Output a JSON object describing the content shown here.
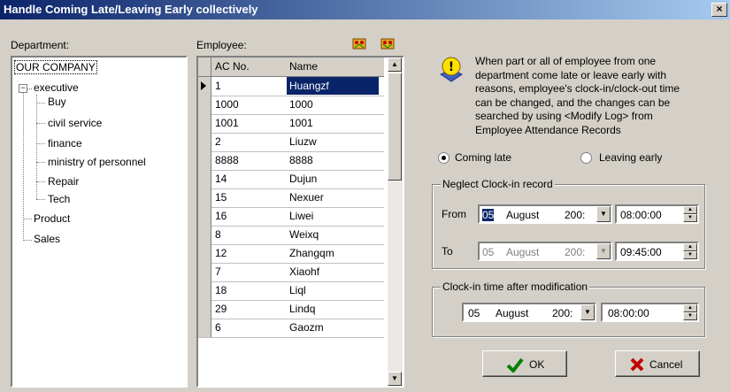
{
  "window": {
    "title": "Handle Coming Late/Leaving Early collectively",
    "close": "×"
  },
  "labels": {
    "department": "Department:",
    "employee": "Employee:"
  },
  "tree": {
    "root": "OUR COMPANY",
    "executive": "executive",
    "exec_children": [
      "Buy",
      "civil service",
      "finance",
      "ministry of personnel",
      "Repair",
      "Tech"
    ],
    "others": [
      "Product",
      "Sales"
    ]
  },
  "grid": {
    "headers": {
      "ac": "AC No.",
      "name": "Name"
    },
    "rows": [
      {
        "ac": "1",
        "name": "Huangzf"
      },
      {
        "ac": "1000",
        "name": "1000"
      },
      {
        "ac": "1001",
        "name": "1001"
      },
      {
        "ac": "2",
        "name": "Liuzw"
      },
      {
        "ac": "8888",
        "name": "8888"
      },
      {
        "ac": "14",
        "name": "Dujun"
      },
      {
        "ac": "15",
        "name": "Nexuer"
      },
      {
        "ac": "16",
        "name": "Liwei"
      },
      {
        "ac": "8",
        "name": "Weixq"
      },
      {
        "ac": "12",
        "name": "Zhangqm"
      },
      {
        "ac": "7",
        "name": "Xiaohf"
      },
      {
        "ac": "18",
        "name": "Liql"
      },
      {
        "ac": "29",
        "name": "Lindq"
      },
      {
        "ac": "6",
        "name": "Gaozm"
      }
    ]
  },
  "info": {
    "text": "When part or all of employee from one department come late or leave early with reasons, employee's clock-in/clock-out time can be changed, and the changes can be searched  by using <Modify Log> from Employee Attendance Records"
  },
  "options": {
    "coming_late": "Coming late",
    "leaving_early": "Leaving early",
    "selected": "coming_late"
  },
  "neglect": {
    "title": "Neglect Clock-in record",
    "from_label": "From",
    "from_day": "05",
    "from_month": "August",
    "from_year": "200:",
    "from_time": "08:00:00",
    "to_label": "To",
    "to_day": "05",
    "to_month": "August",
    "to_year": "200:",
    "to_time": "09:45:00"
  },
  "modification": {
    "title": "Clock-in time after modification",
    "day": "05",
    "month": "August",
    "year": "200:",
    "time": "08:00:00"
  },
  "buttons": {
    "ok": "OK",
    "cancel": "Cancel"
  },
  "colors": {
    "title_start": "#0a246a",
    "title_end": "#a6caf0",
    "selection": "#0a246a"
  }
}
